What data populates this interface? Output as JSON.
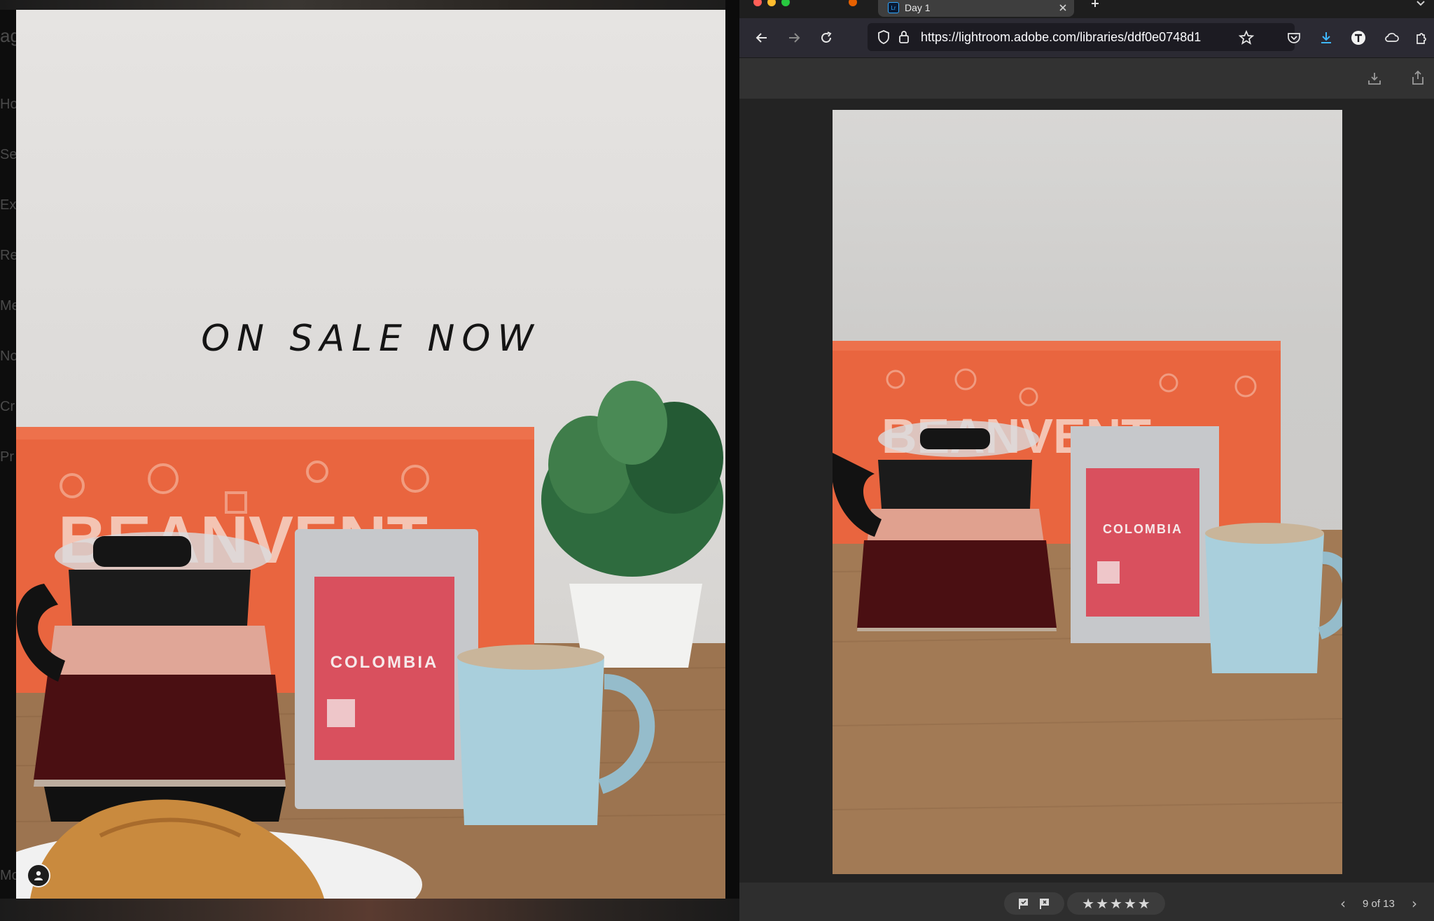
{
  "left_panel": {
    "side_menu_letters": [
      "Ho",
      "Se",
      "Ex",
      "Re",
      "Me",
      "No",
      "Cr",
      "Pr",
      "Mo"
    ],
    "poster": {
      "headline": "ON SALE NOW",
      "packet_title": "COLOMBIA",
      "box_brand": "BEANVENT"
    }
  },
  "browser": {
    "tab": {
      "label": "Day 1",
      "favicon": "Lr"
    },
    "url": "https://lightroom.adobe.com/libraries/ddf0e0748d1",
    "photo": {
      "box_brand": "BEANVENT",
      "packet_title": "COLOMBIA"
    },
    "viewer_footer": {
      "page_counter": "9 of 13",
      "stars": [
        "★",
        "★",
        "★",
        "★",
        "★"
      ]
    }
  },
  "colors": {
    "box_orange": "#e9653f",
    "packet_red": "#d9505e",
    "mug_blue": "#a9cfdc",
    "lightroom_blue": "#31a8ff"
  }
}
